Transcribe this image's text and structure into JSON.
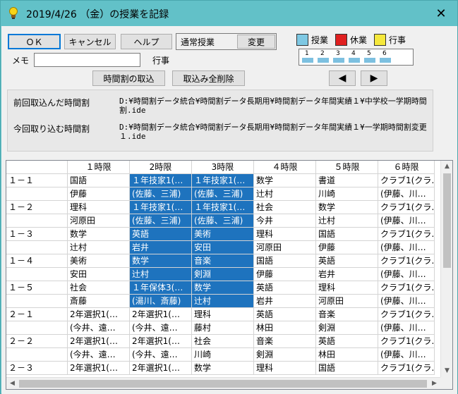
{
  "window": {
    "title": "2019/4/26 （金）の授業を記録",
    "close_glyph": "✕"
  },
  "toolbar": {
    "ok_label": "ＯＫ",
    "cancel_label": "キャンセル",
    "help_label": "ヘルプ",
    "mode_label": "通常授業",
    "change_label": "変更",
    "import_label": "時間割の取込",
    "delete_all_label": "取込み全削除"
  },
  "memo": {
    "label": "メモ",
    "value": "",
    "event_label": "行事"
  },
  "legend": [
    {
      "label": "授業",
      "color": "#7ec8e3"
    },
    {
      "label": "休業",
      "color": "#e02020"
    },
    {
      "label": "行事",
      "color": "#f5e83c"
    }
  ],
  "period_strip": {
    "periods": [
      "1",
      "2",
      "3",
      "4",
      "5",
      "6"
    ],
    "bar_color": "#7dc0e0"
  },
  "nav": {
    "prev_glyph": "◀",
    "next_glyph": "▶"
  },
  "info": {
    "previous_label": "前回取込んだ時間割",
    "previous_path": "D:¥時間割データ統合¥時間割データ長期用¥時間割データ年間実績１¥中学校一学期時間割.ide",
    "current_label": "今回取り込む時間割",
    "current_path": "D:¥時間割データ統合¥時間割データ長期用¥時間割データ年間実績１¥一学期時間割変更１.ide"
  },
  "grid": {
    "headers": [
      "",
      "１時限",
      "2時限",
      "3時限",
      "４時限",
      "５時限",
      "６時限"
    ],
    "rows": [
      {
        "cells": [
          "１－１",
          "国語",
          "１年技家1(…",
          "１年技家1(…",
          "数学",
          "書道",
          "クラブ1(クラ…"
        ],
        "selected": [
          2,
          3
        ]
      },
      {
        "cells": [
          "",
          "伊藤",
          "(佐藤、三浦)",
          "(佐藤、三浦)",
          "辻村",
          "川崎",
          "(伊藤、川…"
        ],
        "selected": [
          2,
          3
        ]
      },
      {
        "cells": [
          "１－２",
          "理科",
          "１年技家1(…",
          "１年技家1(…",
          "社会",
          "数学",
          "クラブ1(クラ…"
        ],
        "selected": [
          2,
          3
        ]
      },
      {
        "cells": [
          "",
          "河原田",
          "(佐藤、三浦)",
          "(佐藤、三浦)",
          "今井",
          "辻村",
          "(伊藤、川…"
        ],
        "selected": [
          2,
          3
        ]
      },
      {
        "cells": [
          "１－３",
          "数学",
          "英語",
          "美術",
          "理科",
          "国語",
          "クラブ1(クラ…"
        ],
        "selected": [
          2,
          3
        ]
      },
      {
        "cells": [
          "",
          "辻村",
          "岩井",
          "安田",
          "河原田",
          "伊藤",
          "(伊藤、川…"
        ],
        "selected": [
          2,
          3
        ]
      },
      {
        "cells": [
          "１－４",
          "美術",
          "数学",
          "音楽",
          "国語",
          "英語",
          "クラブ1(クラ…"
        ],
        "selected": [
          2,
          3
        ]
      },
      {
        "cells": [
          "",
          "安田",
          "辻村",
          "剣淵",
          "伊藤",
          "岩井",
          "(伊藤、川…"
        ],
        "selected": [
          2,
          3
        ]
      },
      {
        "cells": [
          "１－５",
          "社会",
          "１年保体3(…",
          "数学",
          "英語",
          "理科",
          "クラブ1(クラ…"
        ],
        "selected": [
          2,
          3
        ]
      },
      {
        "cells": [
          "",
          "斎藤",
          "(湯川、斎藤)",
          "辻村",
          "岩井",
          "河原田",
          "(伊藤、川…"
        ],
        "selected": [
          2,
          3
        ]
      },
      {
        "cells": [
          "２－１",
          "2年選択1(…",
          "2年選択1(…",
          "理科",
          "英語",
          "音楽",
          "クラブ1(クラ…"
        ],
        "selected": []
      },
      {
        "cells": [
          "",
          "(今井、遠…",
          "(今井、遠…",
          "藤村",
          "林田",
          "剣淵",
          "(伊藤、川…"
        ],
        "selected": []
      },
      {
        "cells": [
          "２－２",
          "2年選択1(…",
          "2年選択1(…",
          "社会",
          "音楽",
          "英語",
          "クラブ1(クラ…"
        ],
        "selected": []
      },
      {
        "cells": [
          "",
          "(今井、遠…",
          "(今井、遠…",
          "川崎",
          "剣淵",
          "林田",
          "(伊藤、川…"
        ],
        "selected": []
      },
      {
        "cells": [
          "２－３",
          "2年選択1(…",
          "2年選択1(…",
          "数学",
          "理科",
          "国語",
          "クラブ1(クラ…"
        ],
        "selected": []
      }
    ]
  },
  "scrollbar": {
    "up": "▲",
    "down": "▼",
    "left": "◀",
    "right": "▶"
  }
}
